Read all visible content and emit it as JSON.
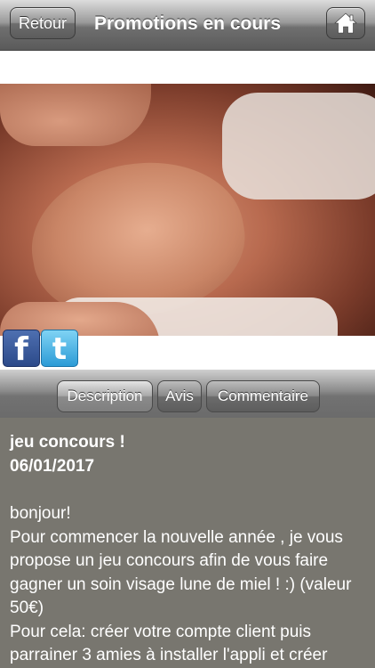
{
  "navbar": {
    "back_label": "Retour",
    "title": "Promotions en cours",
    "home_icon": "home-icon"
  },
  "social": {
    "facebook_letter": "f",
    "twitter_letter": "t",
    "facebook_icon": "facebook-icon",
    "twitter_icon": "twitter-icon"
  },
  "tabs": [
    {
      "label": "Description",
      "active": true
    },
    {
      "label": "Avis",
      "active": false
    },
    {
      "label": "Commentaire",
      "active": false
    }
  ],
  "post": {
    "title": "jeu concours !",
    "date": "06/01/2017",
    "body": "bonjour!\nPour commencer la nouvelle année , je vous propose un jeu concours afin de vous faire gagner un soin visage lune de miel ! :) (valeur 50€)\nPour cela: créer votre compte client puis parrainer 3 amies à installer l'appli et créer"
  },
  "colors": {
    "content_bg": "#78766f",
    "text": "#ffffff"
  }
}
